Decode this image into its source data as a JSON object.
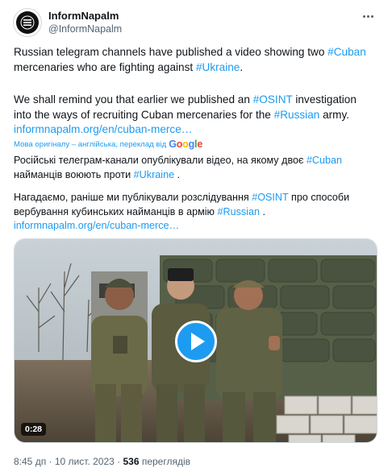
{
  "author": {
    "display_name": "InformNapalm",
    "handle": "@InformNapalm",
    "avatar_icon": "informnapalm-logo-icon"
  },
  "more_icon": "more-horizontal-icon",
  "text_en": {
    "l1a": "Russian telegram channels have published a video showing two ",
    "l1tag": "#Cuban",
    "l2a": "mercenaries who are fighting against ",
    "l2tag": "#Ukraine",
    "l2b": ".",
    "l3a": "We shall remind you that earlier we published an ",
    "l3tag": "#OSINT",
    "l3b": " investigation",
    "l4a": "into the ways of recruiting Cuban mercenaries for the ",
    "l4tag": "#Russian",
    "l4b": " army.",
    "l5link": "informnapalm.org/en/cuban-merce…"
  },
  "translation": {
    "label": "Мова оригіналу – англійська, переклад від",
    "google_g": "G",
    "google_o1": "o",
    "google_o2": "o",
    "google_g2": "g",
    "google_l": "l",
    "google_e": "e"
  },
  "text_ua": {
    "l1a": "Російські телеграм-канали опублікували відео, на якому двоє ",
    "l1tag": "#Cuban",
    "l2a": "найманців воюють проти ",
    "l2tag": "#Ukraine",
    "l2b": " .",
    "l3a": "Нагадаємо, раніше ми публікували розслідування ",
    "l3tag": "#OSINT",
    "l3b": " про способи",
    "l4a": "вербування кубинських найманців в армію ",
    "l4tag": "#Russian",
    "l4b": " .",
    "l5link": "informnapalm.org/en/cuban-merce…"
  },
  "media": {
    "type": "video",
    "duration": "0:28",
    "play_icon": "play-icon"
  },
  "meta": {
    "time": "8:45 дп",
    "sep": " · ",
    "date": "10 лист. 2023",
    "sep2": " · ",
    "views": "536",
    "views_label": " переглядів"
  }
}
